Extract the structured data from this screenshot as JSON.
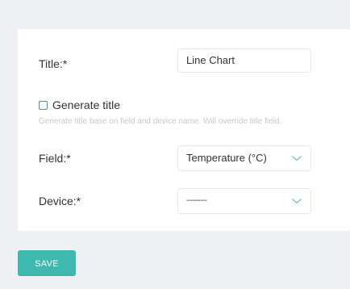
{
  "form": {
    "title_label": "Title:*",
    "title_value": "Line Chart",
    "generate_title_label": "Generate title",
    "generate_title_checked": false,
    "generate_title_hint": "Generate title base on field and device name. Will override title field.",
    "field_label": "Field:*",
    "field_value": "Temperature (°C)",
    "device_label": "Device:*",
    "device_value": "---------"
  },
  "actions": {
    "save_label": "SAVE"
  },
  "colors": {
    "accent": "#3fb8b0",
    "checkbox": "#3d8dd6",
    "chevron": "#8bb8e3",
    "background": "#eef0f4"
  },
  "icons": {
    "field_dropdown": "chevron-down-icon",
    "device_dropdown": "chevron-down-icon"
  }
}
